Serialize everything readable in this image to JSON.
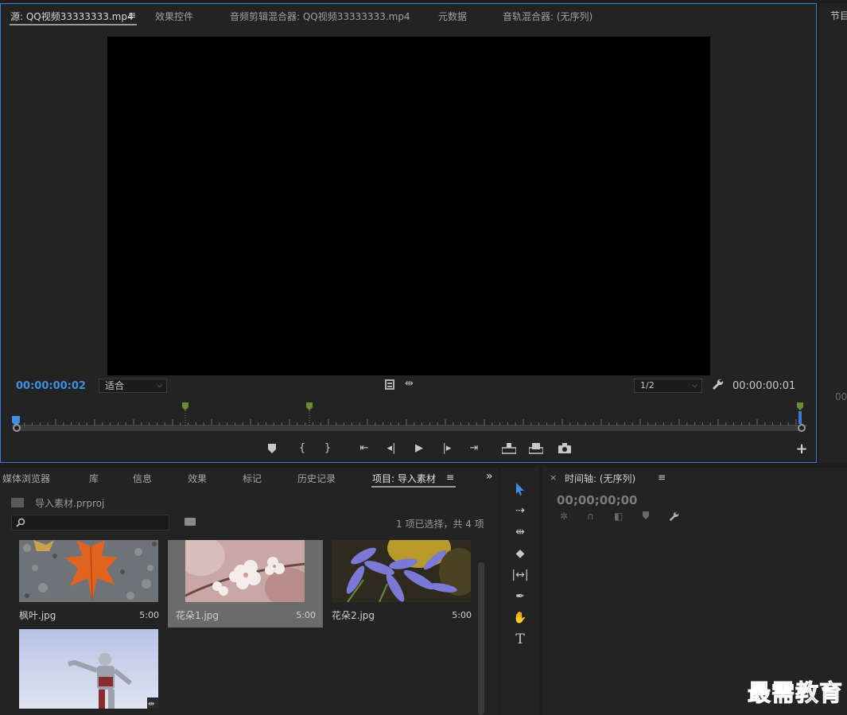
{
  "source_monitor": {
    "tabs": [
      {
        "label": "源: QQ视频33333333.mp4",
        "active": true
      },
      {
        "label": "效果控件"
      },
      {
        "label": "音频剪辑混合器: QQ视频33333333.mp4"
      },
      {
        "label": "元数据"
      },
      {
        "label": "音轨混合器: (无序列)"
      }
    ],
    "menu_glyph": "≡",
    "timecode_current": "00:00:00:02",
    "fit_select": "适合",
    "resolution_select": "1/2",
    "timecode_duration": "00:00:00:01",
    "accent_color": "#3d8fe0"
  },
  "program_monitor": {
    "tab_label": "节目",
    "timecode": "00"
  },
  "project_panel": {
    "tabs": [
      {
        "label": "媒体浏览器"
      },
      {
        "label": "库"
      },
      {
        "label": "信息"
      },
      {
        "label": "效果"
      },
      {
        "label": "标记"
      },
      {
        "label": "历史记录"
      },
      {
        "label": "项目: 导入素材",
        "active": true
      }
    ],
    "overflow_glyph": "»",
    "project_file": "导入素材.prproj",
    "search_placeholder": "",
    "selection_info": "1 项已选择，共 4 项",
    "clips": [
      {
        "name": "枫叶.jpg",
        "duration": "5:00"
      },
      {
        "name": "花朵1.jpg",
        "duration": "5:00",
        "selected": true
      },
      {
        "name": "花朵2.jpg",
        "duration": "5:00"
      },
      {
        "name": "",
        "duration": ""
      }
    ]
  },
  "tools": [
    "selection-tool",
    "track-select-tool",
    "ripple-edit-tool",
    "razor-tool",
    "slip-tool",
    "pen-tool",
    "hand-tool",
    "type-tool"
  ],
  "timeline": {
    "close_glyph": "×",
    "tab_label": "时间轴: (无序列)",
    "timecode": "00;00;00;00"
  },
  "watermark": "最需教育"
}
